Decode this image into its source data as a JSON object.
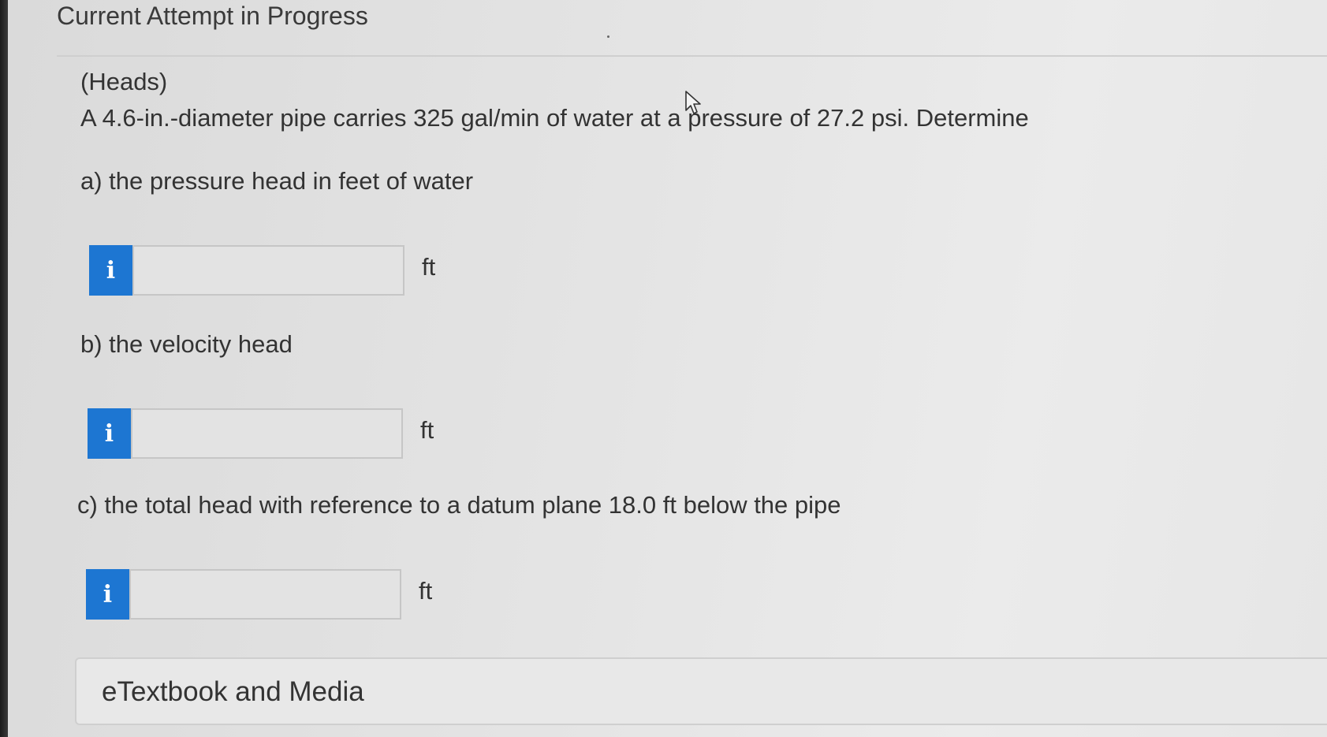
{
  "header": {
    "title": "Current Attempt in Progress"
  },
  "problem": {
    "tag": "(Heads)",
    "statement": "A 4.6-in.-diameter pipe carries 325 gal/min of water at a pressure of 27.2 psi. Determine"
  },
  "questions": [
    {
      "label": "a) the pressure head in feet of water",
      "info_icon": "i",
      "value": "",
      "unit": "ft"
    },
    {
      "label": "b) the velocity head",
      "info_icon": "i",
      "value": "",
      "unit": "ft"
    },
    {
      "label": "c) the total head with reference to a datum plane 18.0 ft below the pipe",
      "info_icon": "i",
      "value": "",
      "unit": "ft"
    }
  ],
  "etextbook": {
    "label": "eTextbook and Media"
  },
  "colors": {
    "info_button": "#1d76d2",
    "text": "#333333"
  },
  "icons": {
    "info": "info-icon",
    "cursor": "mouse-pointer-icon"
  }
}
